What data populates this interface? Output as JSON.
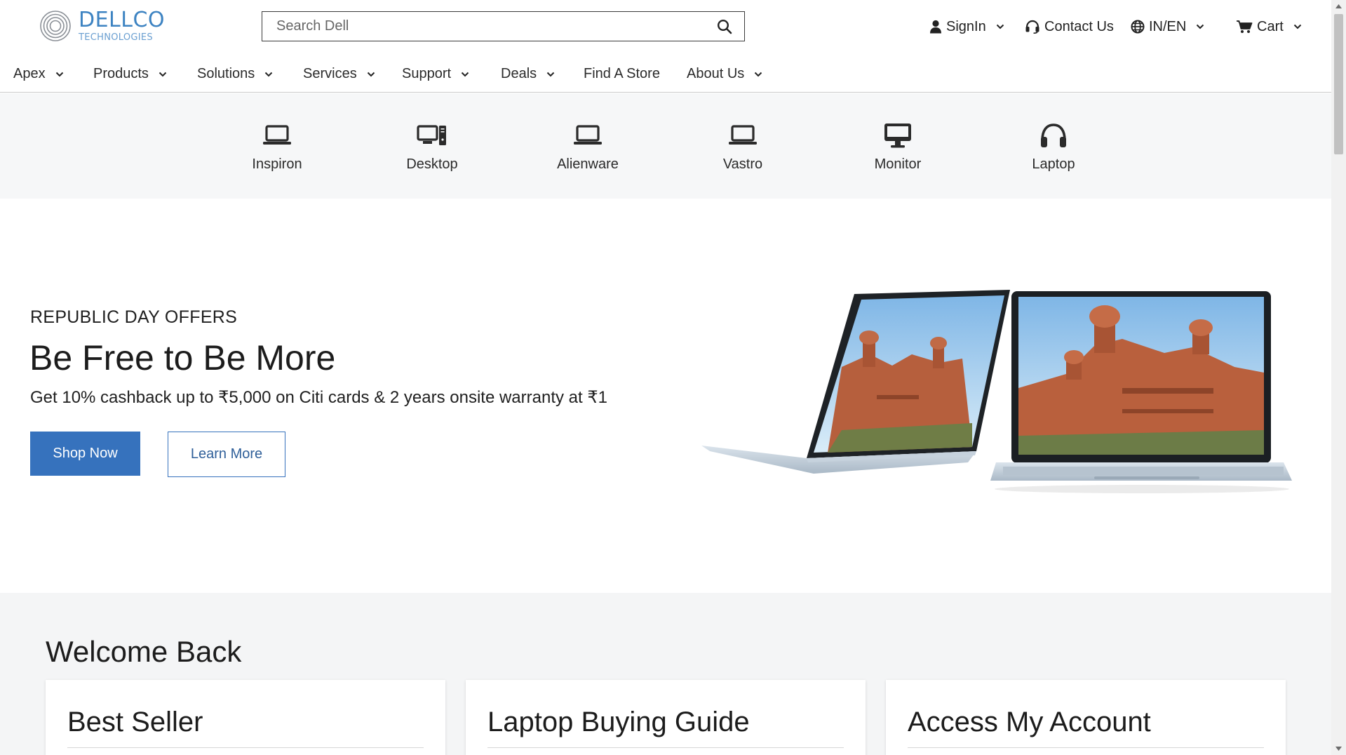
{
  "header": {
    "logo": {
      "name": "DELLCO",
      "sub": "TECHNOLOGIES"
    },
    "search": {
      "placeholder": "Search Dell",
      "icon": "search-icon"
    },
    "utility": {
      "signin": {
        "label": "SignIn",
        "icon": "user-icon"
      },
      "contact": {
        "label": "Contact Us",
        "icon": "headset-icon"
      },
      "lang": {
        "label": "IN/EN",
        "icon": "globe-icon"
      },
      "cart": {
        "label": "Cart",
        "icon": "cart-icon"
      }
    }
  },
  "nav": {
    "items": [
      {
        "label": "Apex",
        "dropdown": true
      },
      {
        "label": "Products",
        "dropdown": true
      },
      {
        "label": "Solutions",
        "dropdown": true
      },
      {
        "label": "Services",
        "dropdown": true
      },
      {
        "label": "Support",
        "dropdown": true
      },
      {
        "label": "Deals",
        "dropdown": true
      },
      {
        "label": "Find A Store",
        "dropdown": false
      },
      {
        "label": "About Us",
        "dropdown": true
      }
    ]
  },
  "categories": [
    {
      "label": "Inspiron",
      "icon": "laptop-icon"
    },
    {
      "label": "Desktop",
      "icon": "desktop-icon"
    },
    {
      "label": "Alienware",
      "icon": "laptop-icon"
    },
    {
      "label": "Vastro",
      "icon": "laptop-icon"
    },
    {
      "label": "Monitor",
      "icon": "monitor-icon"
    },
    {
      "label": "Laptop",
      "icon": "headphones-icon"
    }
  ],
  "hero": {
    "eyebrow": "REPUBLIC DAY OFFERS",
    "title": "Be Free to Be More",
    "subtitle": "Get 10% cashback up to ₹5,000 on Citi cards & 2 years onsite warranty at ₹1",
    "primary_cta": "Shop Now",
    "secondary_cta": "Learn More"
  },
  "welcome": {
    "title": "Welcome Back",
    "cards": [
      {
        "title": "Best Seller"
      },
      {
        "title": "Laptop Buying Guide"
      },
      {
        "title": "Access My Account"
      }
    ]
  },
  "colors": {
    "brand": "#3d83c2",
    "primary_button": "#3672bd",
    "category_bg": "#f6f7f8",
    "welcome_bg": "#f4f5f6"
  }
}
